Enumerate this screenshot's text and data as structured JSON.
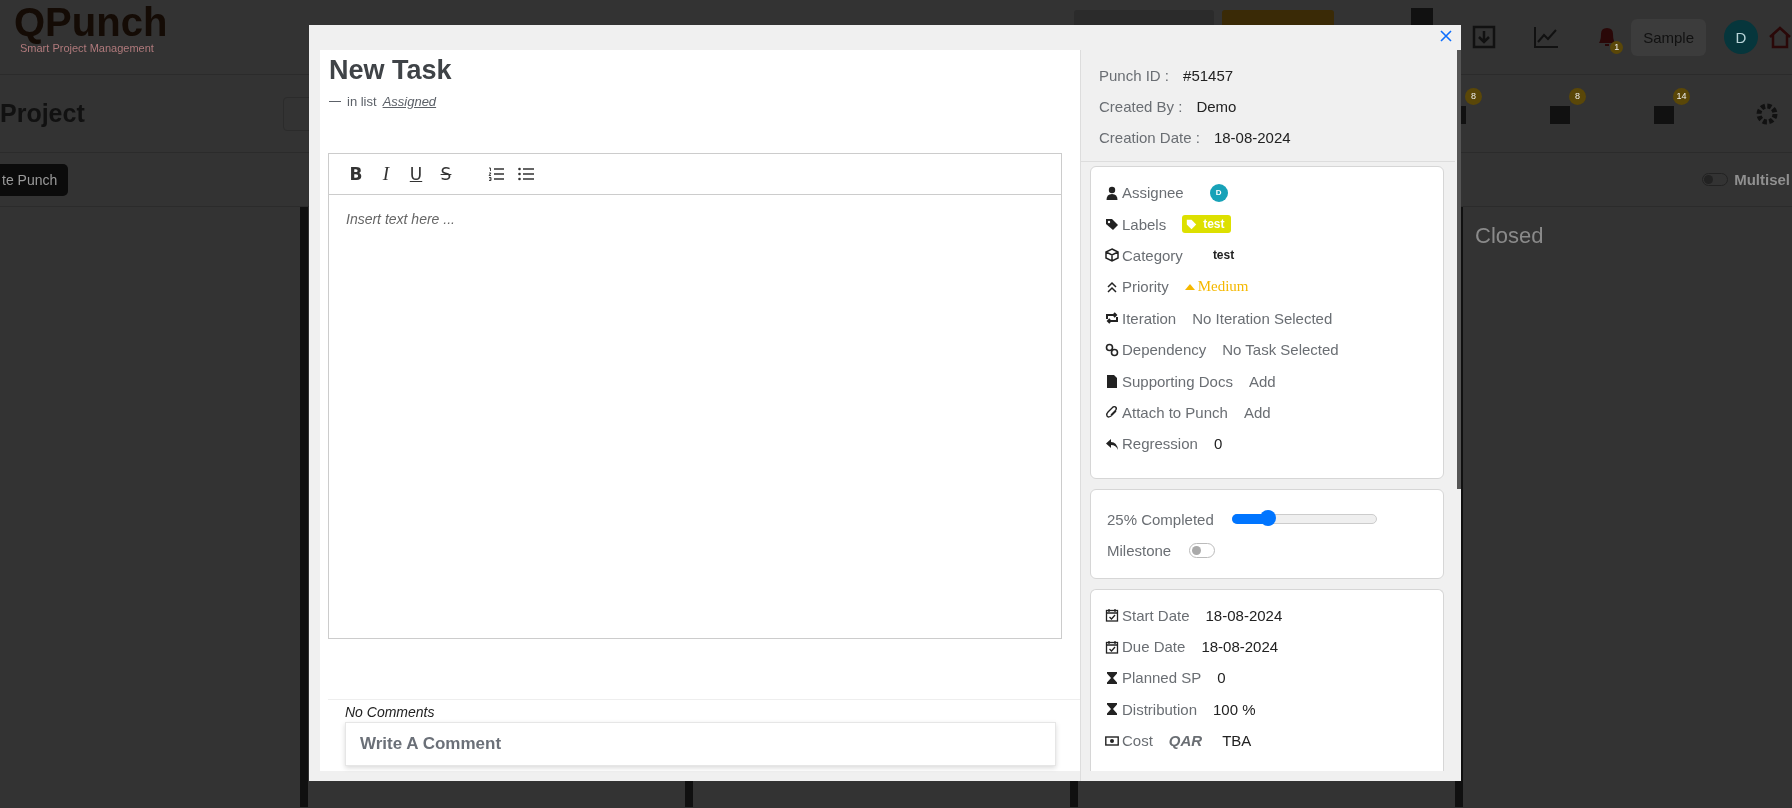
{
  "app": {
    "logo": "QPunch",
    "tagline": "Smart Project Management",
    "notification_count": "1",
    "workspace": "Sample",
    "user_initial": "D",
    "page_title": "Project",
    "view_badges": [
      "8",
      "8",
      "14"
    ],
    "create_button": "te Punch",
    "multiselect": {
      "label": "Multisel",
      "on": false
    },
    "columns": [
      {
        "title": "Closed"
      }
    ]
  },
  "dialog": {
    "title": "New Task",
    "list_prefix": "in list",
    "list_name": "Assigned",
    "toolbar": [
      {
        "kind": "bold",
        "label": "B"
      },
      {
        "kind": "italic",
        "label": "I"
      },
      {
        "kind": "underline",
        "label": "U"
      },
      {
        "kind": "strike",
        "label": "S"
      },
      {
        "kind": "ordered-list"
      },
      {
        "kind": "bullet-list"
      }
    ],
    "editor_placeholder": "Insert text here ...",
    "comments": {
      "empty_text": "No Comments",
      "placeholder": "Write A Comment"
    },
    "meta": [
      {
        "label": "Punch ID :",
        "value": "#51457"
      },
      {
        "label": "Created By :",
        "value": "Demo"
      },
      {
        "label": "Creation Date :",
        "value": "18-08-2024"
      }
    ],
    "details": [
      {
        "kind": "assignee",
        "label": "Assignee",
        "value": "D"
      },
      {
        "kind": "labels",
        "label": "Labels",
        "value": "test"
      },
      {
        "kind": "category",
        "label": "Category",
        "value": "test"
      },
      {
        "kind": "priority",
        "label": "Priority",
        "value": "Medium"
      },
      {
        "kind": "iteration",
        "label": "Iteration",
        "value": "No Iteration Selected"
      },
      {
        "kind": "dependency",
        "label": "Dependency",
        "value": "No Task Selected"
      },
      {
        "kind": "docs",
        "label": "Supporting Docs",
        "value": "Add"
      },
      {
        "kind": "attach",
        "label": "Attach to Punch",
        "value": "Add"
      },
      {
        "kind": "regression",
        "label": "Regression",
        "value": "0"
      }
    ],
    "progress": {
      "label": "25% Completed",
      "level": 0.25
    },
    "milestone": {
      "label": "Milestone",
      "on": false
    },
    "schedule": [
      {
        "kind": "date",
        "label": "Start Date",
        "value": "18-08-2024"
      },
      {
        "kind": "date",
        "label": "Due Date",
        "value": "18-08-2024"
      },
      {
        "kind": "hourglass",
        "label": "Planned SP",
        "value": "0"
      },
      {
        "kind": "hourglass",
        "label": "Distribution",
        "value": "100 %"
      },
      {
        "kind": "cost",
        "label": "Cost",
        "currency": "QAR",
        "value": "TBA"
      }
    ]
  }
}
